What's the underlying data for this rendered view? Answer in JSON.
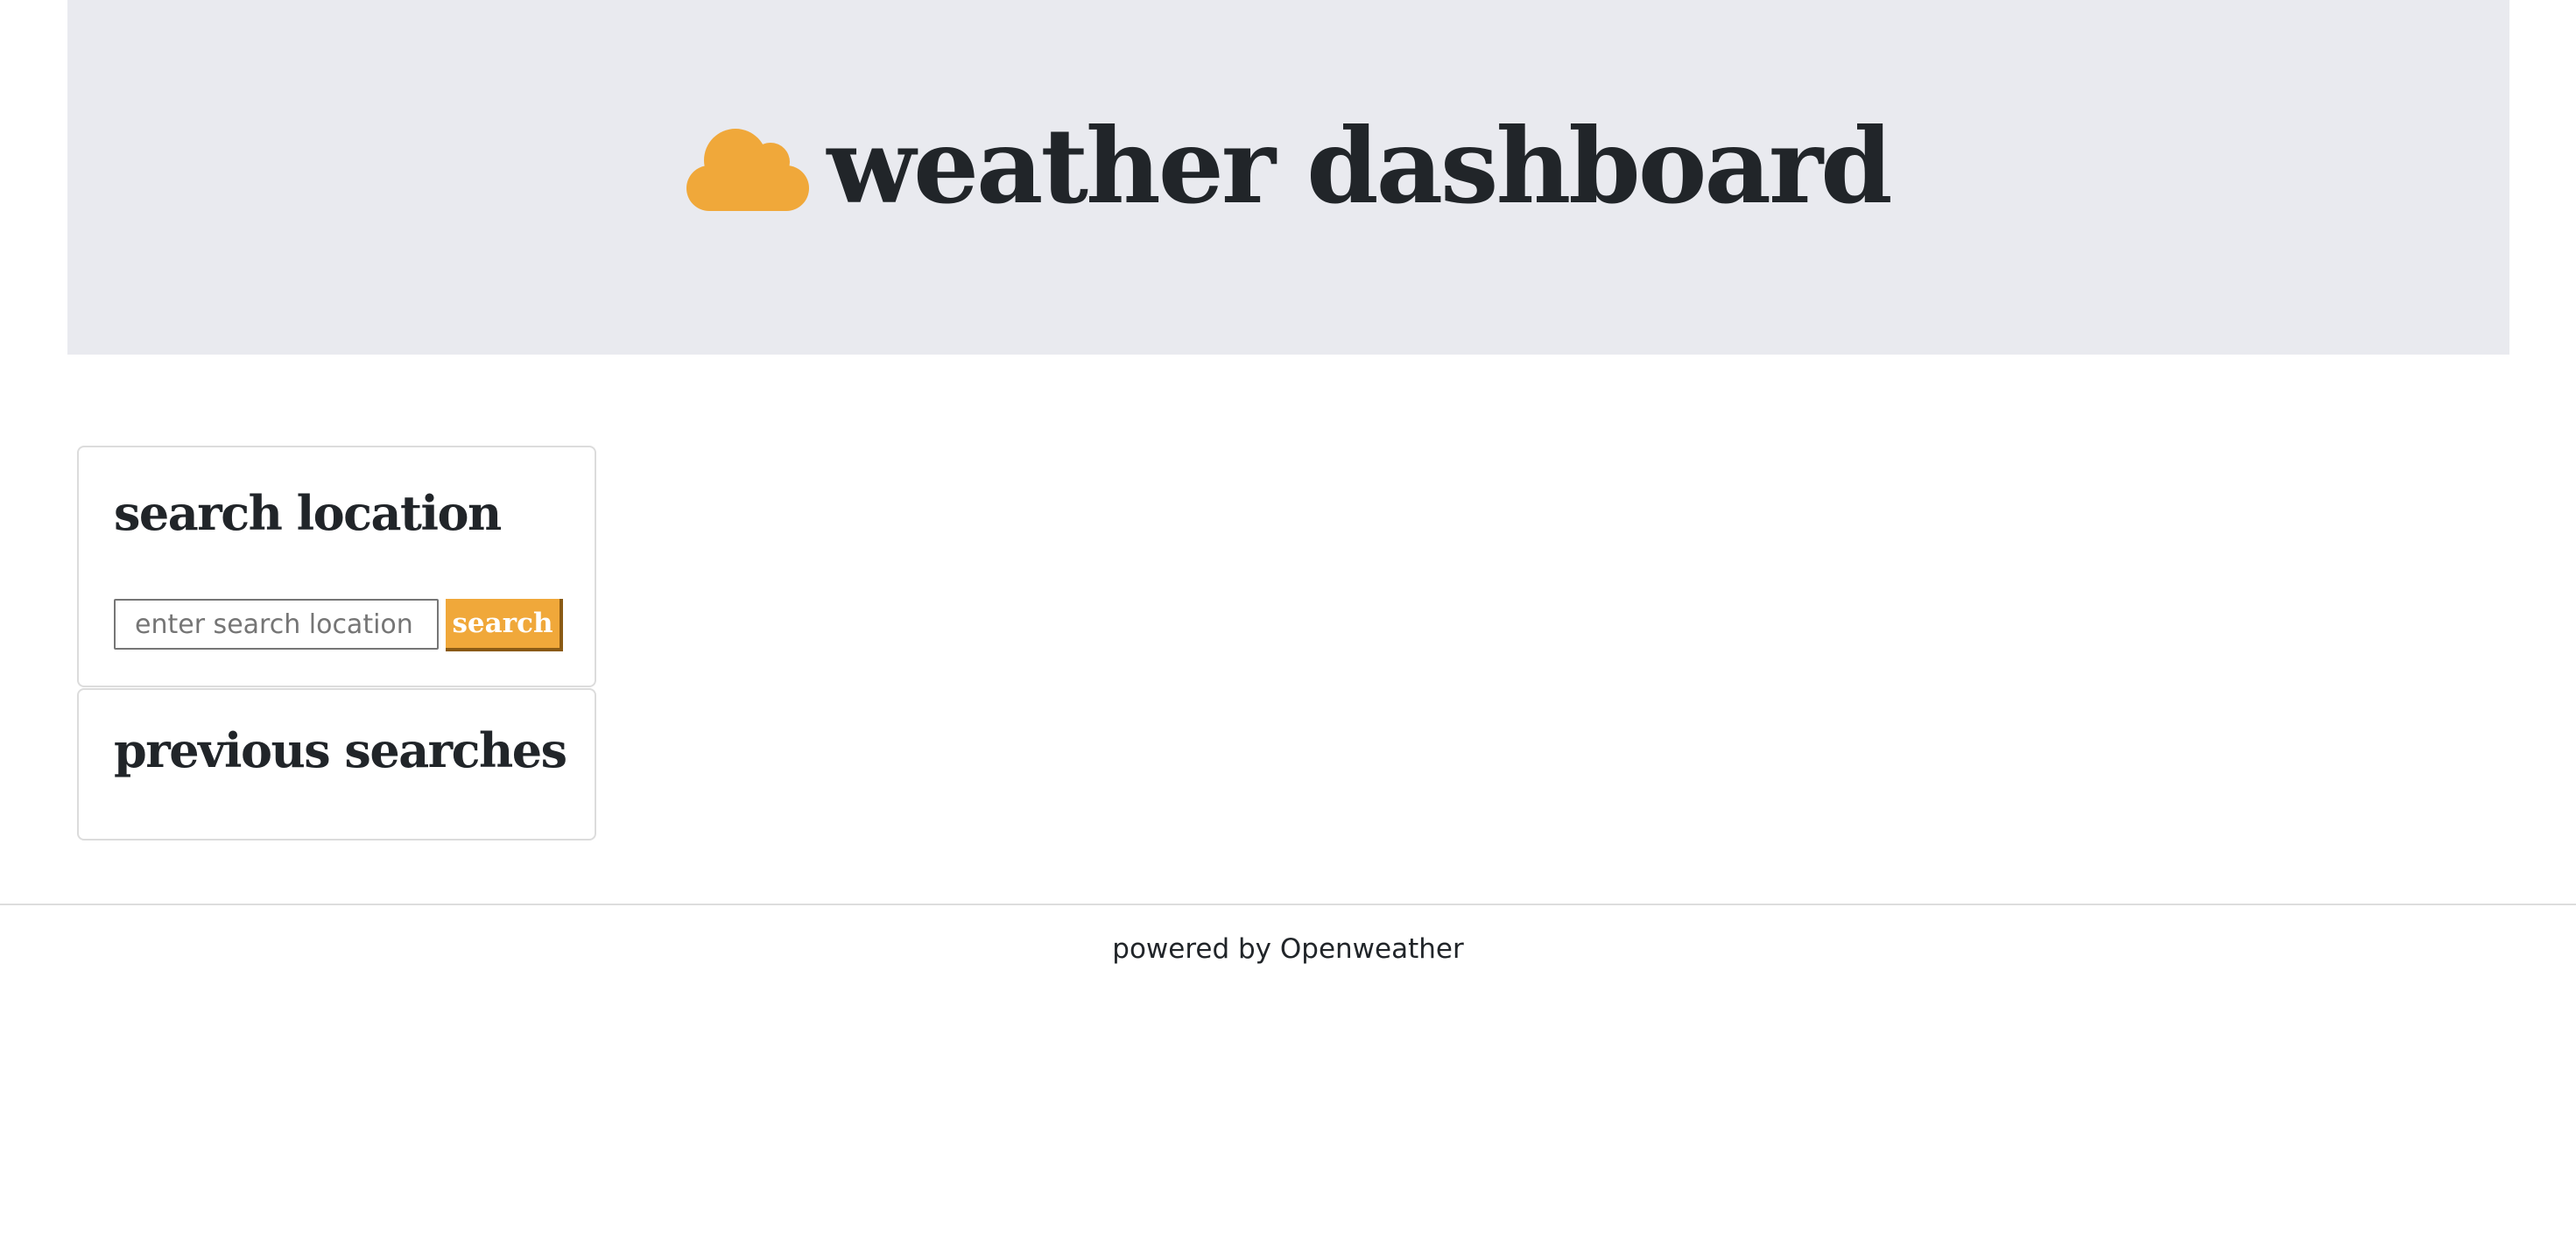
{
  "header": {
    "title": "weather dashboard",
    "icon": "cloud-icon",
    "icon_color": "#f0a83a",
    "background_color": "#e9eaef"
  },
  "search_card": {
    "heading": "search location",
    "input_placeholder": "enter search location",
    "input_value": "",
    "button_label": "search",
    "button_color": "#f0a83a"
  },
  "previous_card": {
    "heading": "previous searches",
    "items": []
  },
  "footer": {
    "text": "powered by Openweather"
  }
}
